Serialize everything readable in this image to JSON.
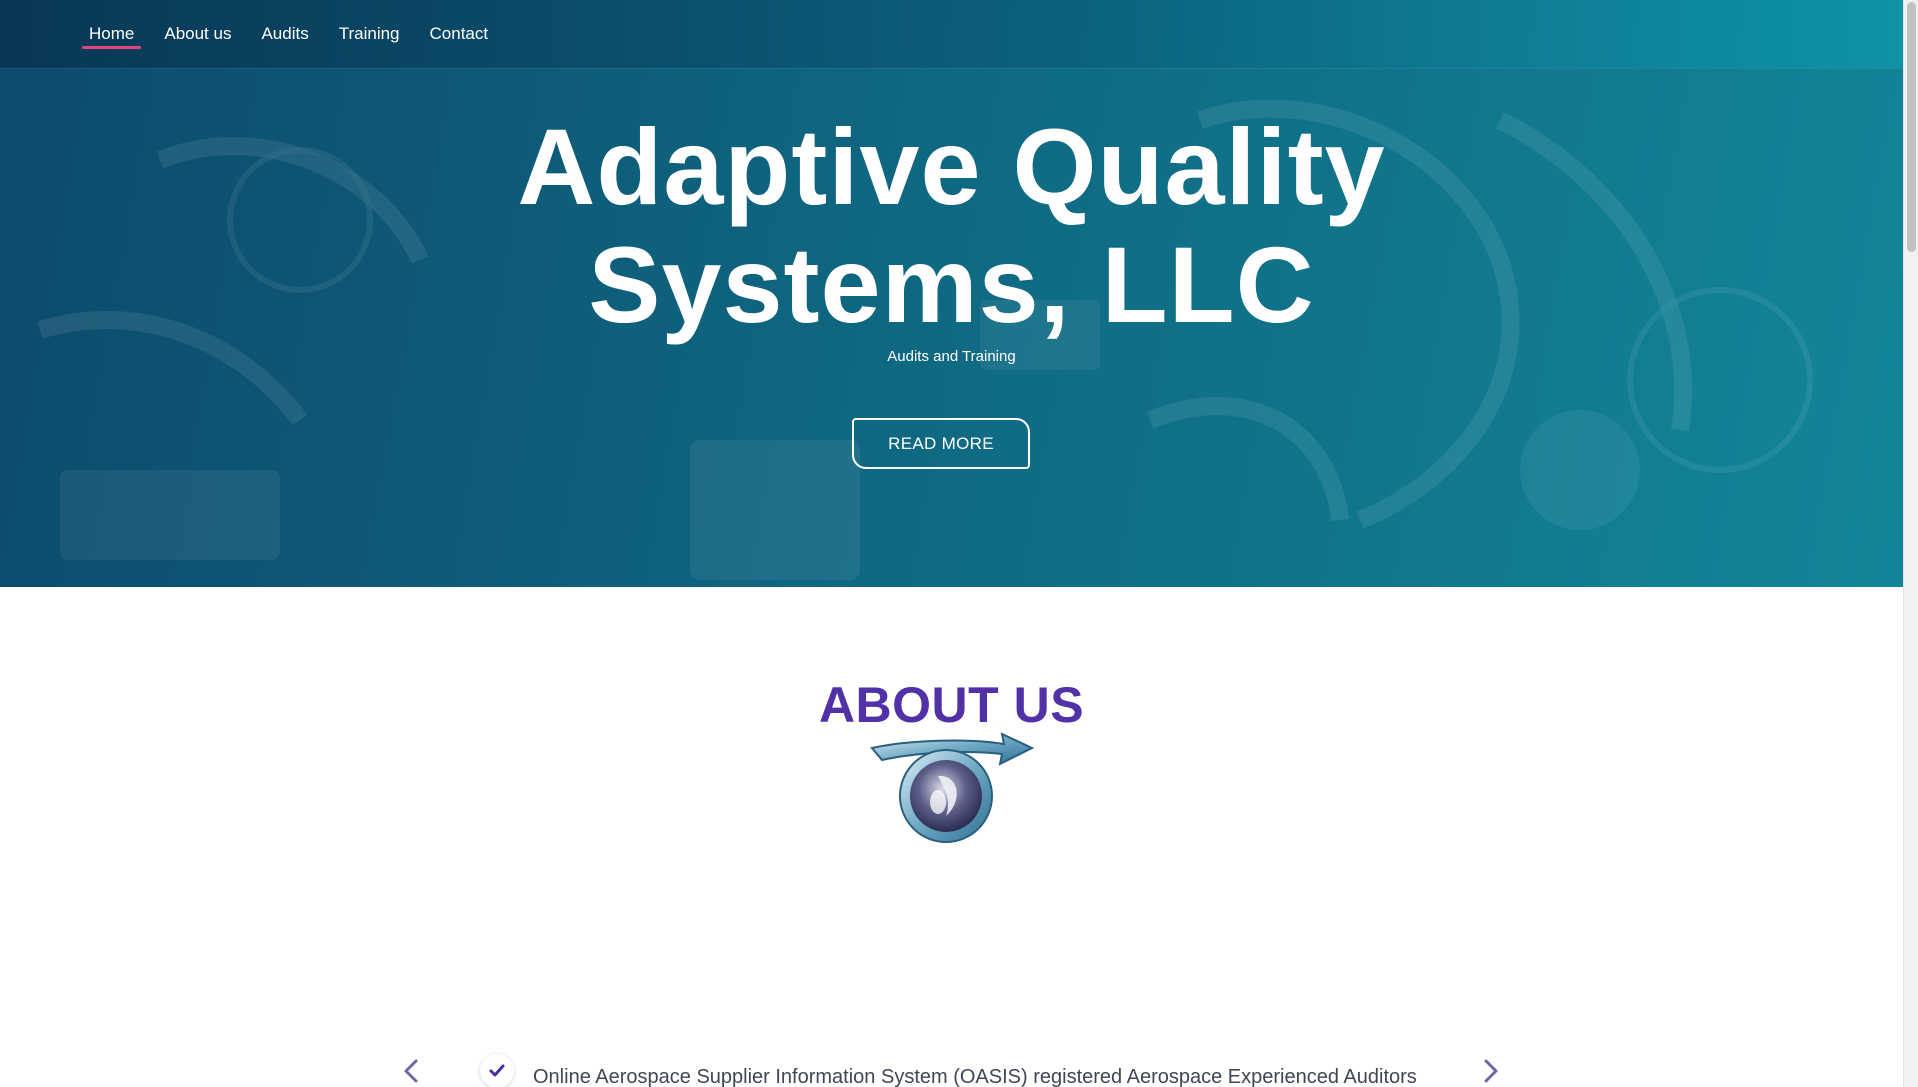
{
  "nav": {
    "items": [
      {
        "label": "Home",
        "active": true
      },
      {
        "label": "About us",
        "active": false
      },
      {
        "label": "Audits",
        "active": false
      },
      {
        "label": "Training",
        "active": false
      },
      {
        "label": "Contact",
        "active": false
      }
    ]
  },
  "hero": {
    "title_line1": "Adaptive Quality",
    "title_line2": "Systems, LLC",
    "subtitle": "Audits and Training",
    "button_label": "READ MORE"
  },
  "about": {
    "heading": "ABOUT US",
    "carousel_text": "Online Aerospace Supplier Information System (OASIS) registered Aerospace Experienced Auditors"
  },
  "icons": {
    "prev": "chevron-left-icon",
    "next": "chevron-right-icon",
    "check": "check-icon",
    "logo": "company-logo"
  },
  "colors": {
    "accent_underline": "#e0467a",
    "heading_purple": "#5230a8",
    "hero_dark": "#0c4a6b",
    "hero_light": "#128698"
  }
}
